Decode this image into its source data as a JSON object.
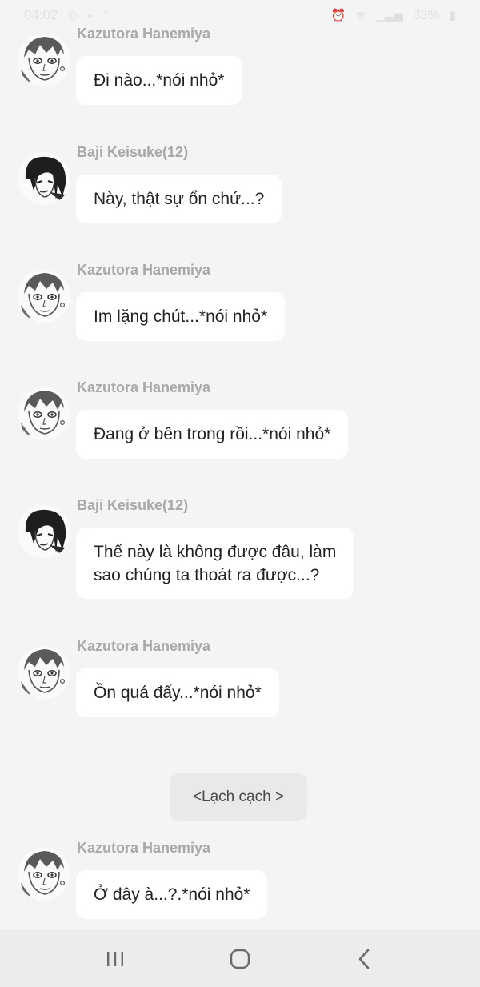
{
  "status_bar": {
    "time": "04:02",
    "battery": "33%"
  },
  "messages": [
    {
      "sender": "Kazutora Hanemiya",
      "avatar": "kazutora",
      "text": "Đi nào...*nói nhỏ*"
    },
    {
      "sender": "Baji Keisuke(12)",
      "avatar": "baji",
      "text": "Này, thật sự ổn chứ...?"
    },
    {
      "sender": "Kazutora Hanemiya",
      "avatar": "kazutora",
      "text": "Im lặng chút...*nói nhỏ*"
    },
    {
      "sender": "Kazutora Hanemiya",
      "avatar": "kazutora",
      "text": "Đang ở bên trong rồi...*nói nhỏ*"
    },
    {
      "sender": "Baji Keisuke(12)",
      "avatar": "baji",
      "text_lines": [
        "Thế này là không được đâu, làm",
        "sao chúng ta thoát ra được...?"
      ]
    },
    {
      "sender": "Kazutora Hanemiya",
      "avatar": "kazutora",
      "text": "Ồn quá đấy...*nói nhỏ*"
    },
    {
      "sender": "Kazutora Hanemiya",
      "avatar": "kazutora",
      "text": "Ở đây à...?.*nói nhỏ*"
    }
  ],
  "system_note": "<Lạch cạch >",
  "nav": {
    "recents_icon": "recents-icon",
    "home_icon": "home-icon",
    "back_icon": "back-icon"
  },
  "colors": {
    "background": "#f4f4f4",
    "bubble": "#ffffff",
    "sender_name": "#a8a8a8",
    "system_pill": "#e9e9e9",
    "nav_bar": "#ececec"
  }
}
